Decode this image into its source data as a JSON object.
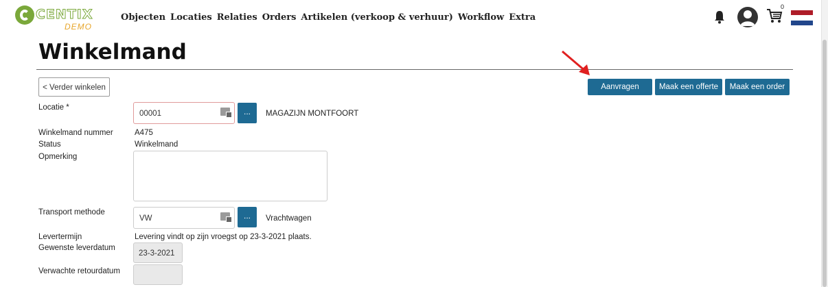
{
  "brand": {
    "name": "CENTIX",
    "sub": "DEMO"
  },
  "nav": [
    "Objecten",
    "Locaties",
    "Relaties",
    "Orders",
    "Artikelen (verkoop & verhuur)",
    "Workflow",
    "Extra"
  ],
  "cart_count": "0",
  "flag_colors": [
    "#ae1c28",
    "#ffffff",
    "#21468b"
  ],
  "page_title": "Winkelmand",
  "buttons": {
    "back": "< Verder winkelen",
    "aanvragen": "Aanvragen",
    "offerte": "Maak een offerte",
    "order": "Maak een order",
    "dots": "..."
  },
  "form": {
    "locatie_label": "Locatie *",
    "locatie_value": "00001",
    "locatie_name": "MAGAZIJN MONTFOORT",
    "nummer_label": "Winkelmand nummer",
    "nummer_value": "A475",
    "status_label": "Status",
    "status_value": "Winkelmand",
    "opmerking_label": "Opmerking",
    "transport_label": "Transport methode",
    "transport_value": "VW",
    "transport_name": "Vrachtwagen",
    "levertermijn_label": "Levertermijn",
    "levertermijn_value": "Levering vindt op zijn vroegst op 23-3-2021 plaats.",
    "leverdatum_label": "Gewenste leverdatum",
    "leverdatum_value": "23-3-2021",
    "retourdatum_label": "Verwachte retourdatum"
  },
  "colors": {
    "accent": "#1e6a93",
    "annotation_arrow": "#e02020"
  }
}
